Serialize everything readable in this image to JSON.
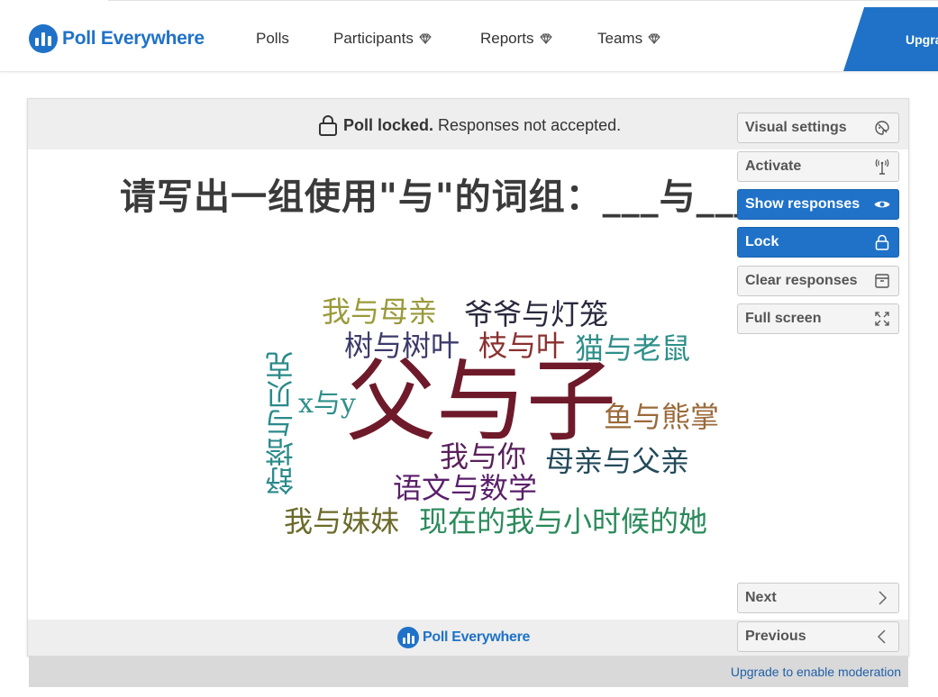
{
  "nav": {
    "logo_text": "Poll Everywhere",
    "items": [
      {
        "label": "Polls",
        "premium": false
      },
      {
        "label": "Participants",
        "premium": true
      },
      {
        "label": "Reports",
        "premium": true
      },
      {
        "label": "Teams",
        "premium": true
      }
    ],
    "upgrade_label": "Upgra"
  },
  "poll": {
    "lock_bold": "Poll locked.",
    "lock_text": "Responses not accepted.",
    "question": "请写出一组使用\"与\"的词组：___与___"
  },
  "controls": {
    "visual_settings": "Visual settings",
    "activate": "Activate",
    "show_responses": "Show responses",
    "lock": "Lock",
    "clear_responses": "Clear responses",
    "full_screen": "Full screen",
    "next": "Next",
    "previous": "Previous"
  },
  "word_cloud": [
    {
      "text": "父与子",
      "color": "#6e1a2a"
    },
    {
      "text": "我与母亲",
      "color": "#9a9a3a"
    },
    {
      "text": "爷爷与灯笼",
      "color": "#2a2a3e"
    },
    {
      "text": "树与树叶",
      "color": "#3b3a6a"
    },
    {
      "text": "枝与叶",
      "color": "#8a3030"
    },
    {
      "text": "猫与老鼠",
      "color": "#2f8f8a"
    },
    {
      "text": "x与y",
      "color": "#2f8f8a"
    },
    {
      "text": "鱼与熊掌",
      "color": "#9a6a3a"
    },
    {
      "text": "我与你",
      "color": "#5a1f5a"
    },
    {
      "text": "母亲与父亲",
      "color": "#234a5a"
    },
    {
      "text": "语文与数学",
      "color": "#5a1f6a"
    },
    {
      "text": "我与妹妹",
      "color": "#6b6a2a"
    },
    {
      "text": "现在的我与小时候的她",
      "color": "#2a8a5a"
    },
    {
      "text": "舒塔与贝克",
      "color": "#2a8a8a"
    }
  ],
  "footer": {
    "logo_text": "Poll Everywhere",
    "moderation_link": "Upgrade to enable moderation"
  },
  "colors": {
    "brand_blue": "#1f72c8"
  }
}
